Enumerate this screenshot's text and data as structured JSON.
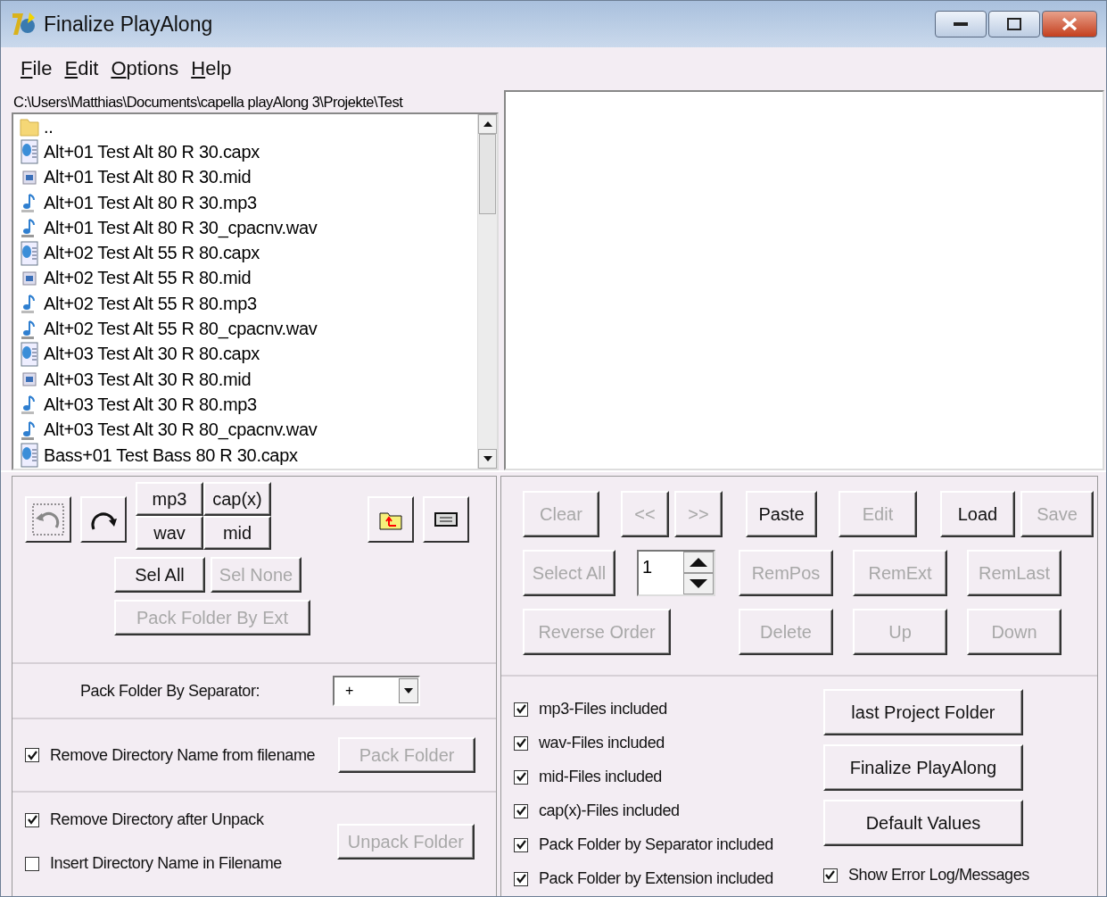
{
  "window": {
    "title": "Finalize PlayAlong"
  },
  "menu": [
    {
      "label": "File"
    },
    {
      "label": "Edit"
    },
    {
      "label": "Options"
    },
    {
      "label": "Help"
    }
  ],
  "path": "C:\\Users\\Matthias\\Documents\\capella playAlong 3\\Projekte\\Test",
  "files": [
    {
      "name": "..",
      "kind": "folder"
    },
    {
      "name": "Alt+01 Test Alt 80 R 30.capx",
      "kind": "capx"
    },
    {
      "name": "Alt+01 Test Alt 80 R 30.mid",
      "kind": "mid"
    },
    {
      "name": "Alt+01 Test Alt 80 R 30.mp3",
      "kind": "mp3"
    },
    {
      "name": "Alt+01 Test Alt 80 R 30_cpacnv.wav",
      "kind": "wav"
    },
    {
      "name": "Alt+02 Test Alt 55 R 80.capx",
      "kind": "capx"
    },
    {
      "name": "Alt+02 Test Alt 55 R 80.mid",
      "kind": "mid"
    },
    {
      "name": "Alt+02 Test Alt 55 R 80.mp3",
      "kind": "mp3"
    },
    {
      "name": "Alt+02 Test Alt 55 R 80_cpacnv.wav",
      "kind": "wav"
    },
    {
      "name": "Alt+03 Test Alt 30 R 80.capx",
      "kind": "capx"
    },
    {
      "name": "Alt+03 Test Alt 30 R 80.mid",
      "kind": "mid"
    },
    {
      "name": "Alt+03 Test Alt 30 R 80.mp3",
      "kind": "mp3"
    },
    {
      "name": "Alt+03 Test Alt 30 R 80_cpacnv.wav",
      "kind": "wav"
    },
    {
      "name": "Bass+01 Test Bass 80 R 30.capx",
      "kind": "capx"
    }
  ],
  "ext_buttons": [
    {
      "label": "mp3"
    },
    {
      "label": "cap(x)"
    },
    {
      "label": "wav"
    },
    {
      "label": "mid"
    }
  ],
  "sel_buttons": [
    {
      "label": "Sel All",
      "disabled": false
    },
    {
      "label": "Sel None",
      "disabled": true
    }
  ],
  "pack_by_ext": {
    "label": "Pack Folder By Ext",
    "disabled": true
  },
  "separator": {
    "label": "Pack Folder By Separator:",
    "value": "+"
  },
  "remove_dir_name": {
    "label": "Remove Directory Name from filename",
    "checked": true
  },
  "pack_folder": {
    "label": "Pack Folder",
    "disabled": true
  },
  "remove_dir_after": {
    "label": "Remove Directory after Unpack",
    "checked": true
  },
  "insert_dir_name": {
    "label": "Insert Directory Name in Filename",
    "checked": false
  },
  "unpack_folder": {
    "label": "Unpack Folder",
    "disabled": true
  },
  "list_row1": [
    {
      "label": "Clear",
      "disabled": true
    },
    {
      "label": "<<",
      "disabled": true
    },
    {
      "label": ">>",
      "disabled": true
    },
    {
      "label": "Paste",
      "disabled": false
    },
    {
      "label": "Edit",
      "disabled": true
    },
    {
      "label": "Load",
      "disabled": false
    },
    {
      "label": "Save",
      "disabled": true
    }
  ],
  "select_all": {
    "label": "Select All",
    "disabled": true
  },
  "spin_value": "1",
  "list_row2": [
    {
      "label": "RemPos",
      "disabled": true
    },
    {
      "label": "RemExt",
      "disabled": true
    },
    {
      "label": "RemLast",
      "disabled": true
    }
  ],
  "reverse_order": {
    "label": "Reverse Order",
    "disabled": true
  },
  "list_row3": [
    {
      "label": "Delete",
      "disabled": true
    },
    {
      "label": "Up",
      "disabled": true
    },
    {
      "label": "Down",
      "disabled": true
    }
  ],
  "options": [
    {
      "label": "mp3-Files included",
      "checked": true
    },
    {
      "label": "wav-Files included",
      "checked": true
    },
    {
      "label": "mid-Files included",
      "checked": true
    },
    {
      "label": "cap(x)-Files included",
      "checked": true
    },
    {
      "label": "Pack Folder by Separator included",
      "checked": true
    },
    {
      "label": "Pack Folder by Extension included",
      "checked": true
    }
  ],
  "actions": [
    {
      "label": "last Project Folder"
    },
    {
      "label": "Finalize PlayAlong"
    },
    {
      "label": "Default Values"
    }
  ],
  "show_log": {
    "label": "Show Error Log/Messages",
    "checked": true
  }
}
